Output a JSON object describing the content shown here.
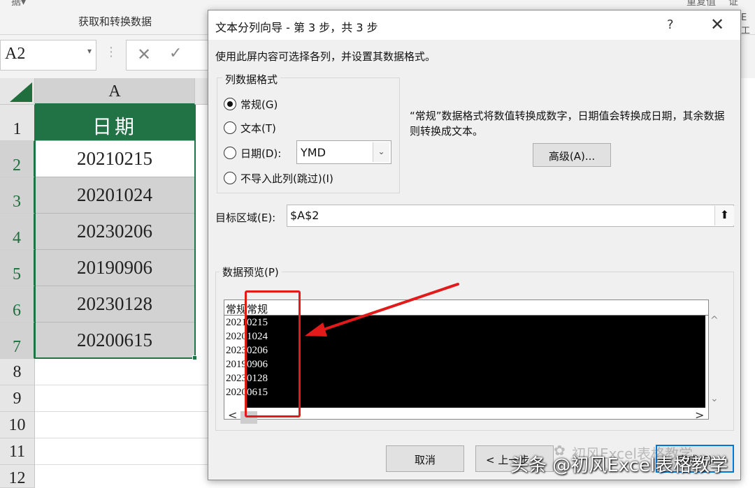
{
  "ribbon": {
    "top_left_partial": "据▾",
    "group_label": "获取和转换数据",
    "right_partial_1": "重复值",
    "right_partial_2": "证",
    "far_right_partial": "E工"
  },
  "formula_bar": {
    "name_box": "A2",
    "name_box_dropdown": "▾",
    "separator": "⋮",
    "cancel_icon_glyph": "✕",
    "enter_icon_glyph": "✓"
  },
  "sheet": {
    "column_header": "A",
    "row_numbers": [
      "1",
      "2",
      "3",
      "4",
      "5",
      "6",
      "7",
      "8",
      "9",
      "10",
      "11",
      "12"
    ],
    "header_cell": "日期",
    "cells": [
      "20210215",
      "20201024",
      "20230206",
      "20190906",
      "20230128",
      "20200615"
    ]
  },
  "dialog": {
    "title": "文本分列向导 - 第 3 步，共 3 步",
    "help_glyph": "?",
    "close_glyph": "✕",
    "instruction": "使用此屏内容可选择各列，并设置其数据格式。",
    "column_format_legend": "列数据格式",
    "radio_general": "常规(G)",
    "radio_text": "文本(T)",
    "radio_date": "日期(D):",
    "radio_skip": "不导入此列(跳过)(I)",
    "date_format_value": "YMD",
    "select_arrow": "⌄",
    "description": "“常规”数据格式将数值转换成数字，日期值会转换成日期，其余数据则转换成文本。",
    "advanced_button": "高级(A)...",
    "destination_label": "目标区域(E):",
    "destination_value": "$A$2",
    "destination_picker_glyph": "⬆",
    "preview_legend": "数据预览(P)",
    "preview_header": "常规常规",
    "preview_rows": [
      {
        "left": "2021",
        "right": "0215"
      },
      {
        "left": "2020",
        "right": "1024"
      },
      {
        "left": "2023",
        "right": "0206"
      },
      {
        "left": "2019",
        "right": "0906"
      },
      {
        "left": "2023",
        "right": "0128"
      },
      {
        "left": "2020",
        "right": "0615"
      }
    ],
    "scroll_up": "^",
    "scroll_down": "⌄",
    "scroll_left": "<",
    "scroll_right": ">",
    "cancel_button": "取消",
    "prev_button": "< 上一步",
    "finish_button": "完成(F)"
  },
  "watermark": {
    "text": "头条 @初风Excel表格教学",
    "ghost_text": "初风Excel表格教学"
  },
  "colors": {
    "excel_green": "#217346",
    "annotation_red": "#e31a1a",
    "focus_blue": "#0078d7"
  }
}
